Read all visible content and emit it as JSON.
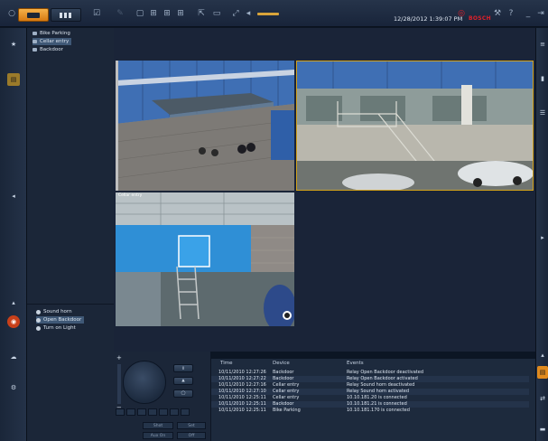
{
  "toolbar": {
    "datetime": "12/28/2012 1:39:07 PM",
    "brand": "BOSCH",
    "icons": [
      "camera-mode-icon",
      "playback-mode-icon",
      "checkbox-icon",
      "layout-1x1-icon",
      "layout-2x2-icon",
      "layout-3x3-icon",
      "layout-4x4-icon",
      "pointer-icon",
      "screen-icon",
      "fullscreen-icon",
      "audio-icon",
      "slider-icon",
      "wrench-icon",
      "help-icon",
      "minimize-icon",
      "exit-icon"
    ],
    "accent": "#f0a030"
  },
  "tree": {
    "items": [
      {
        "label": "Bike Parking",
        "selected": false
      },
      {
        "label": "Cellar entry",
        "selected": true
      },
      {
        "label": "Backdoor",
        "selected": false
      }
    ]
  },
  "relays": {
    "items": [
      {
        "label": "Sound horn",
        "selected": false
      },
      {
        "label": "Open Backdoor",
        "selected": true
      },
      {
        "label": "Turn on Light",
        "selected": false
      }
    ]
  },
  "cameras": {
    "cam3_title": "Cellar entry"
  },
  "ptz": {
    "zoom_plus": "+",
    "zoom_minus": "−",
    "buttons": [
      "Shot",
      "Set",
      "Aux On",
      "Off"
    ]
  },
  "eventlog": {
    "headers": {
      "time": "Time",
      "device": "Device",
      "events": "Events"
    },
    "rows": [
      {
        "time": "10/11/2010 12:27:26",
        "device": "Backdoor",
        "event": "Relay Open Backdoor deactivated"
      },
      {
        "time": "10/11/2010 12:27:22",
        "device": "Backdoor",
        "event": "Relay Open Backdoor activated"
      },
      {
        "time": "10/11/2010 12:27:16",
        "device": "Cellar entry",
        "event": "Relay Sound horn deactivated"
      },
      {
        "time": "10/11/2010 12:27:10",
        "device": "Cellar entry",
        "event": "Relay Sound horn activated"
      },
      {
        "time": "10/11/2010 12:25:11",
        "device": "Cellar entry",
        "event": "10.10.181.20 is connected"
      },
      {
        "time": "10/11/2010 12:25:11",
        "device": "Backdoor",
        "event": "10.10.181.21 is connected"
      },
      {
        "time": "10/11/2010 12:25:11",
        "device": "Bike Parking",
        "event": "10.10.181.170 is connected"
      }
    ]
  }
}
